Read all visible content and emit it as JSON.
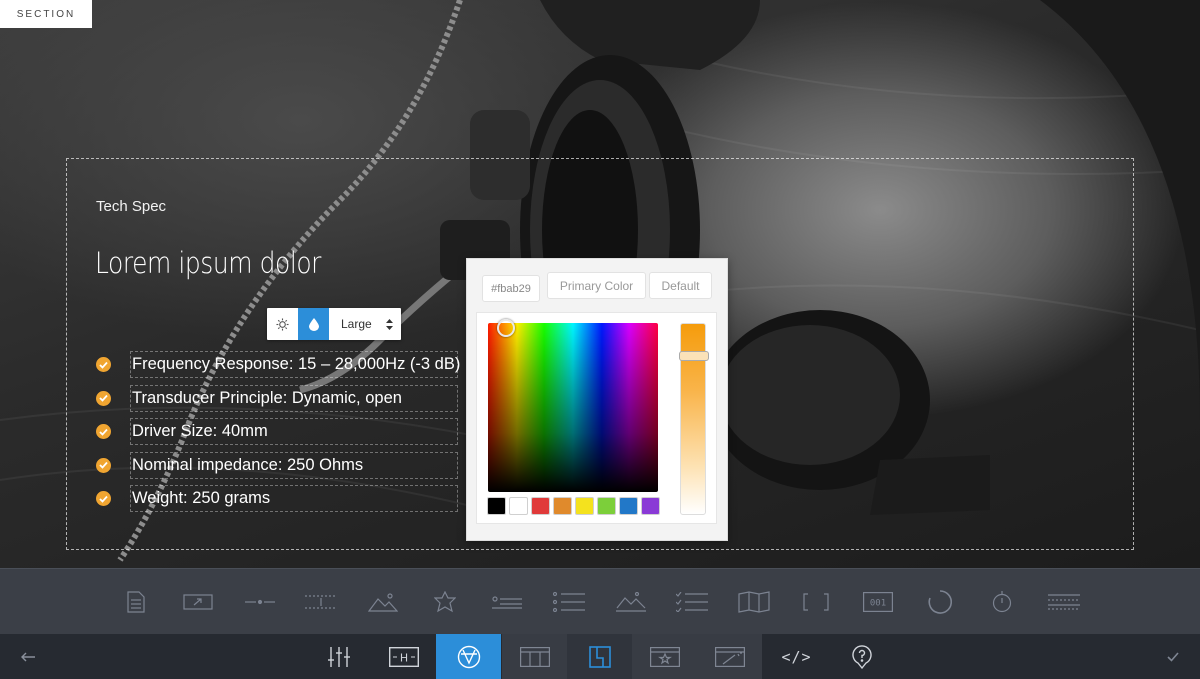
{
  "section_tag": "SECTION",
  "hero": {
    "eyebrow": "Tech Spec",
    "headline": "Lorem ipsum dolor",
    "specs": [
      "Frequency Response: 15 – 28,000Hz (-3 dB)",
      "Transducer Principle: Dynamic, open",
      "Driver Size: 40mm",
      "Nominal impedance: 250 Ohms",
      "Weight: 250 grams"
    ]
  },
  "mini_toolbar": {
    "size_value": "Large",
    "buttons": [
      "sun-icon",
      "droplet-icon"
    ]
  },
  "color_picker": {
    "hex_value": "#fbab29",
    "primary_label": "Primary Color",
    "default_label": "Default",
    "swatches": [
      "#000000",
      "#ffffff",
      "#e03a3a",
      "#e08a2c",
      "#f4e21e",
      "#7ccf3a",
      "#2278c8",
      "#8a3ad6"
    ]
  },
  "element_tray": {
    "icons": [
      "document-icon",
      "image-link-icon",
      "divider-icon",
      "spacer-icon",
      "image-icon",
      "star-badge-icon",
      "list-block-icon",
      "bullet-list-icon",
      "gallery-icon",
      "checklist-icon",
      "map-icon",
      "brackets-icon",
      "counter-icon",
      "circle-progress-icon",
      "timer-icon",
      "lines-icon"
    ]
  },
  "main_toolbar": {
    "counter_label": "001",
    "heading_label": "H",
    "code_label": "</>"
  },
  "colors": {
    "accent": "#2c8ed9",
    "check": "#f0a531",
    "tray_bg": "#3b3f47",
    "bar_bg": "#262a31"
  }
}
